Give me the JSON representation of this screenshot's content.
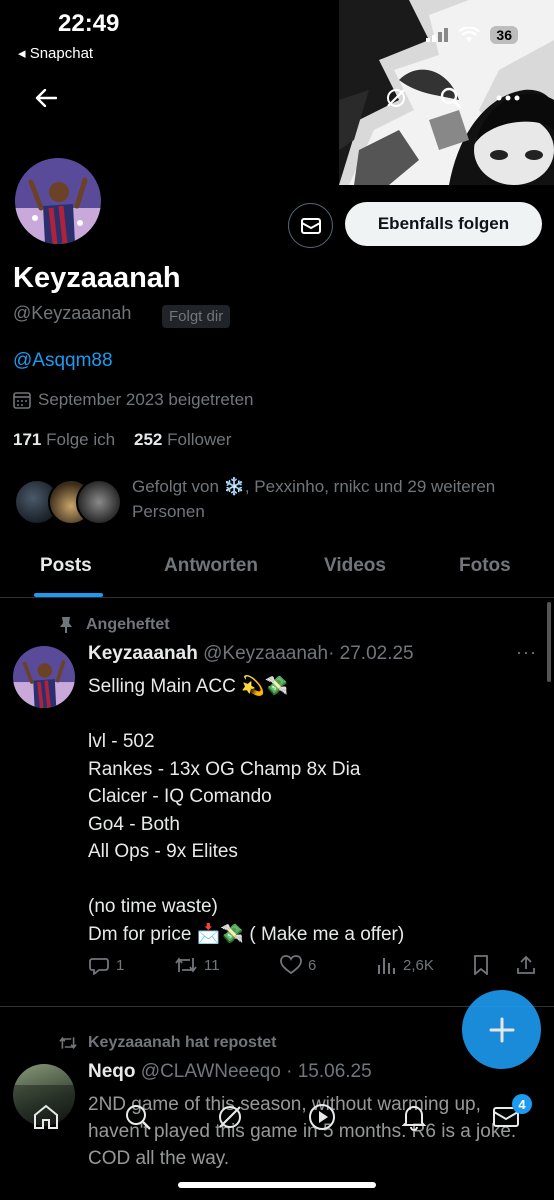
{
  "status_bar": {
    "time": "22:49",
    "back_app": "◂ Snapchat",
    "battery": "36"
  },
  "topbar": {
    "back_icon": "arrow-left-icon",
    "grok_icon": "grok-icon",
    "search_icon": "search-icon",
    "more_icon": "more-icon"
  },
  "profile": {
    "name": "Keyzaaanah",
    "handle": "@Keyzaaanah",
    "follows_you": "Folgt dir",
    "bio_link": "@Asqqm88",
    "joined": "September 2023 beigetreten",
    "following_count": "171",
    "following_label": "Folge ich",
    "followers_count": "252",
    "followers_label": "Follower",
    "followed_by": "Gefolgt von ❄️, Pexxinho, rnikc und 29 weiteren Personen",
    "follow_button": "Ebenfalls folgen"
  },
  "tabs": [
    {
      "label": "Posts",
      "active": true
    },
    {
      "label": "Antworten",
      "active": false
    },
    {
      "label": "Videos",
      "active": false
    },
    {
      "label": "Fotos",
      "active": false
    }
  ],
  "pinned_tweet": {
    "pinned_label": "Angeheftet",
    "name": "Keyzaaanah",
    "handle": "@Keyzaaanah",
    "date": "· 27.02.25",
    "more": "···",
    "body": "Selling Main ACC 💫💸\n\nlvl - 502\nRankes - 13x OG Champ 8x Dia\nClaicer - IQ Comando\nGo4 - Both\nAll Ops - 9x Elites\n\n(no time waste)\nDm for price 📩💸 ( Make me a offer)",
    "replies": "1",
    "reposts": "11",
    "likes": "6",
    "views": "2,6K"
  },
  "repost_tweet": {
    "repost_label": "Keyzaaanah hat repostet",
    "name": "Neqo",
    "handle": "@CLAWNeeeqo",
    "date": "· 15.06.25",
    "body": "2ND game of this season, without warming up, haven't played this game in 5 months. R6 is a joke. COD all the way."
  },
  "bottom_nav": {
    "badge": "4"
  },
  "colors": {
    "accent": "#1d9bf0",
    "muted": "#71767b",
    "text": "#e7e9ea"
  }
}
